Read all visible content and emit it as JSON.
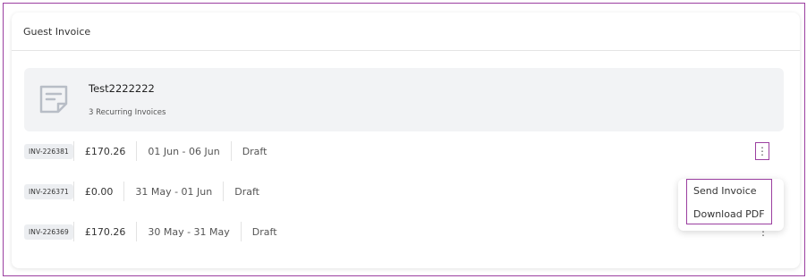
{
  "card": {
    "title": "Guest Invoice"
  },
  "summary": {
    "icon": "document-icon",
    "title": "Test2222222",
    "subtitle": "3 Recurring Invoices"
  },
  "invoices": [
    {
      "id": "INV-226381",
      "amount": "£170.26",
      "dates": "01 Jun - 06 Jun",
      "status": "Draft"
    },
    {
      "id": "INV-226371",
      "amount": "£0.00",
      "dates": "31 May - 01 Jun",
      "status": "Draft"
    },
    {
      "id": "INV-226369",
      "amount": "£170.26",
      "dates": "30 May - 31 May",
      "status": "Draft"
    }
  ],
  "menu": {
    "items": [
      "Send Invoice",
      "Download PDF"
    ]
  },
  "icons": {
    "more": "⋮"
  },
  "colors": {
    "accent_outline": "#9b3fa0",
    "summary_bg": "#f2f3f5",
    "badge_bg": "#eceef1"
  }
}
